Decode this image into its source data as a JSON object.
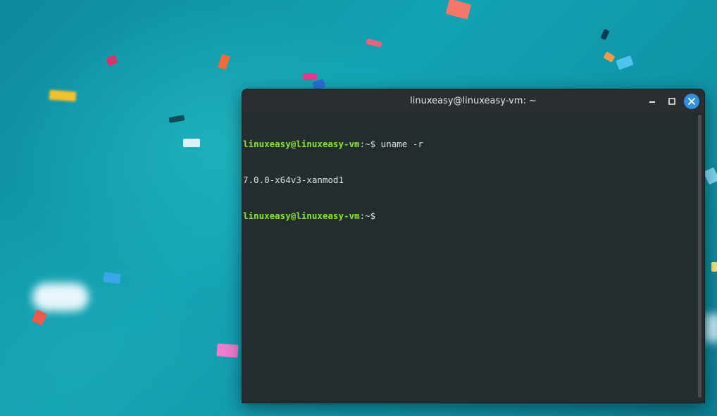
{
  "window": {
    "title": "linuxeasy@linuxeasy-vm: ~",
    "buttons": [
      "minimize-icon",
      "maximize-icon",
      "close-icon"
    ],
    "accent_close": "#2f8fe0"
  },
  "terminal": {
    "lines": [
      {
        "user_host": "linuxeasy@linuxeasy-vm",
        "path": ":~$",
        "command": " uname -r"
      },
      {
        "output": "7.0.0-x64v3-xanmod1"
      },
      {
        "user_host": "linuxeasy@linuxeasy-vm",
        "path": ":~$",
        "command": ""
      }
    ],
    "colors": {
      "prompt": "#8ae234",
      "text": "#e0e0e0",
      "background": "#24282b"
    }
  }
}
